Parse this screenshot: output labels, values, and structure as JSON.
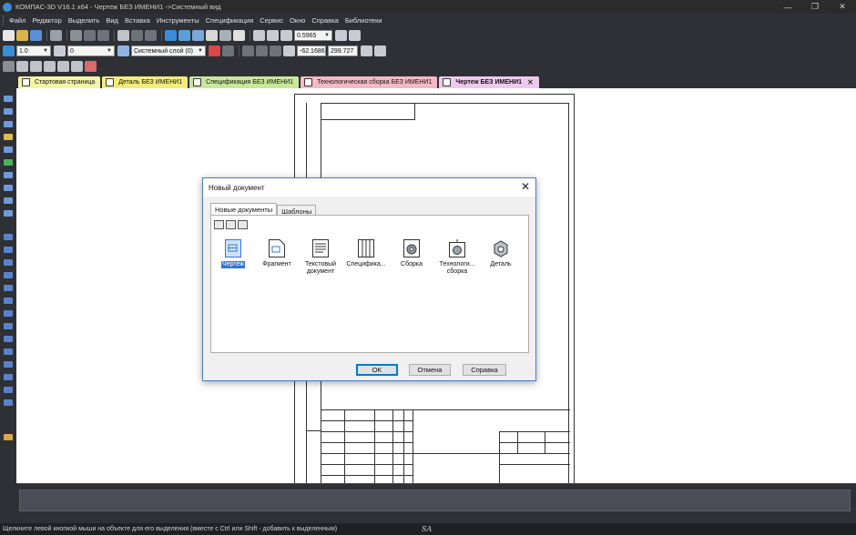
{
  "window": {
    "title": "КОМПАС-3D V16.1 x64 - Чертеж БЕЗ ИМЕНИ1 ->Системный вид",
    "minimize": "—",
    "restore": "❐",
    "close": "✕"
  },
  "menu": [
    {
      "label": "Файл"
    },
    {
      "label": "Редактор"
    },
    {
      "label": "Выделить"
    },
    {
      "label": "Вид"
    },
    {
      "label": "Вставка"
    },
    {
      "label": "Инструменты"
    },
    {
      "label": "Спецификация"
    },
    {
      "label": "Сервис"
    },
    {
      "label": "Окно"
    },
    {
      "label": "Справка"
    },
    {
      "label": "Библиотеки"
    }
  ],
  "toolbar": {
    "zoom_value": "0.5965",
    "line_scale": "1.0",
    "layer_number": "0",
    "layer_name": "Системный слой (0)",
    "coord_x": "-62.1686",
    "coord_y": "299.727"
  },
  "doc_tabs": [
    {
      "label": "Стартовая страница",
      "color": "#f5f5a8"
    },
    {
      "label": "Деталь БЕЗ ИМЕНИ1",
      "color": "#f3ec7a"
    },
    {
      "label": "Спецификация БЕЗ ИМЕНИ1",
      "color": "#c9e79a"
    },
    {
      "label": "Технологическая сборка БЕЗ ИМЕНИ1",
      "color": "#f3b9c4"
    },
    {
      "label": "Чертеж БЕЗ ИМЕНИ1",
      "color": "#eec9ee",
      "close": "✕"
    }
  ],
  "dialog": {
    "title": "Новый документ",
    "close": "✕",
    "tabs": [
      {
        "label": "Новые документы"
      },
      {
        "label": "Шаблоны"
      }
    ],
    "documents": [
      {
        "label": "Чертеж",
        "icon": "drawing-icon",
        "selected": true
      },
      {
        "label": "Фрагмент",
        "icon": "fragment-icon"
      },
      {
        "label": "Текстовый документ",
        "icon": "text-document-icon"
      },
      {
        "label": "Специфика...",
        "icon": "specification-icon"
      },
      {
        "label": "Сборка",
        "icon": "assembly-icon"
      },
      {
        "label": "Технологи... сборка",
        "icon": "tech-assembly-icon"
      },
      {
        "label": "Деталь",
        "icon": "part-icon"
      }
    ],
    "ok": "OK",
    "cancel": "Отмена",
    "help": "Справка"
  },
  "status": {
    "message": "Щелкните левой кнопкой мыши на объекте для его выделения (вместе с Ctrl или Shift - добавить к выделенным)",
    "sa": "SA"
  }
}
